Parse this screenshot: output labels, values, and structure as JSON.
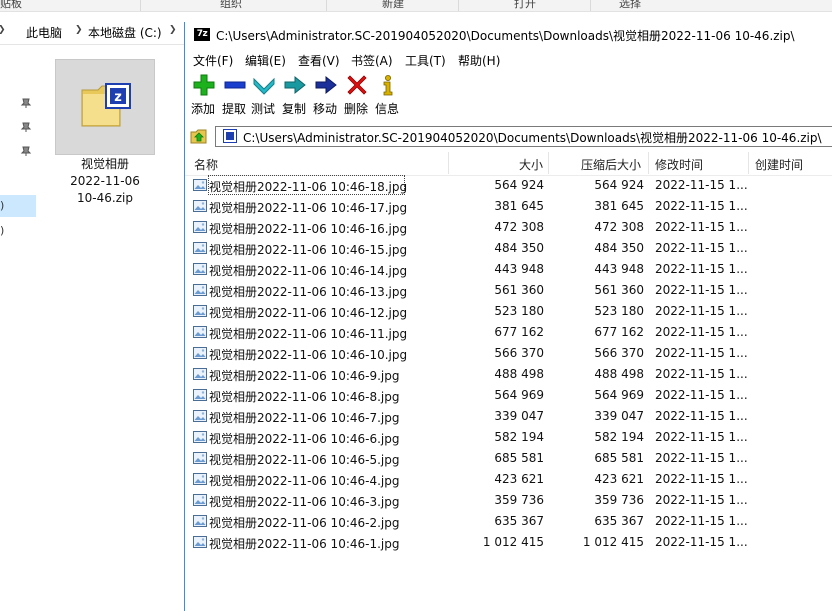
{
  "explorer": {
    "ribbon": [
      "贴板",
      "组织",
      "新建",
      "打开",
      "选择"
    ],
    "breadcrumb": [
      "此电脑",
      "本地磁盘 (C:)"
    ],
    "nav_fragments": [
      ")",
      ")"
    ],
    "selected_file": {
      "line1": "视觉相册",
      "line2": "2022-11-06",
      "line3": "10-46.zip"
    }
  },
  "sevenzip": {
    "app_logo": "7z",
    "title": "C:\\Users\\Administrator.SC-201904052020\\Documents\\Downloads\\视觉相册2022-11-06 10-46.zip\\",
    "menu": [
      "文件(F)",
      "编辑(E)",
      "查看(V)",
      "书签(A)",
      "工具(T)",
      "帮助(H)"
    ],
    "toolbar": [
      {
        "label": "添加",
        "icon": "plus-icon",
        "color": "#1db21d"
      },
      {
        "label": "提取",
        "icon": "minus-icon",
        "color": "#1a3fcf"
      },
      {
        "label": "测试",
        "icon": "check-chevron-icon",
        "color": "#26b9c8"
      },
      {
        "label": "复制",
        "icon": "copy-arrow-icon",
        "color": "#1a9aa0"
      },
      {
        "label": "移动",
        "icon": "arrow-right-icon",
        "color": "#1a2f9a"
      },
      {
        "label": "删除",
        "icon": "delete-x-icon",
        "color": "#e01010"
      },
      {
        "label": "信息",
        "icon": "info-icon",
        "color": "#d8b000"
      }
    ],
    "path": "C:\\Users\\Administrator.SC-201904052020\\Documents\\Downloads\\视觉相册2022-11-06 10-46.zip\\",
    "columns": {
      "name": "名称",
      "size": "大小",
      "packed": "压缩后大小",
      "modified": "修改时间",
      "created": "创建时间"
    },
    "files": [
      {
        "name": "视觉相册2022-11-06 10:46-18.jpg",
        "size": "564 924",
        "packed": "564 924",
        "modified": "2022-11-15 1..."
      },
      {
        "name": "视觉相册2022-11-06 10:46-17.jpg",
        "size": "381 645",
        "packed": "381 645",
        "modified": "2022-11-15 1..."
      },
      {
        "name": "视觉相册2022-11-06 10:46-16.jpg",
        "size": "472 308",
        "packed": "472 308",
        "modified": "2022-11-15 1..."
      },
      {
        "name": "视觉相册2022-11-06 10:46-15.jpg",
        "size": "484 350",
        "packed": "484 350",
        "modified": "2022-11-15 1..."
      },
      {
        "name": "视觉相册2022-11-06 10:46-14.jpg",
        "size": "443 948",
        "packed": "443 948",
        "modified": "2022-11-15 1..."
      },
      {
        "name": "视觉相册2022-11-06 10:46-13.jpg",
        "size": "561 360",
        "packed": "561 360",
        "modified": "2022-11-15 1..."
      },
      {
        "name": "视觉相册2022-11-06 10:46-12.jpg",
        "size": "523 180",
        "packed": "523 180",
        "modified": "2022-11-15 1..."
      },
      {
        "name": "视觉相册2022-11-06 10:46-11.jpg",
        "size": "677 162",
        "packed": "677 162",
        "modified": "2022-11-15 1..."
      },
      {
        "name": "视觉相册2022-11-06 10:46-10.jpg",
        "size": "566 370",
        "packed": "566 370",
        "modified": "2022-11-15 1..."
      },
      {
        "name": "视觉相册2022-11-06 10:46-9.jpg",
        "size": "488 498",
        "packed": "488 498",
        "modified": "2022-11-15 1..."
      },
      {
        "name": "视觉相册2022-11-06 10:46-8.jpg",
        "size": "564 969",
        "packed": "564 969",
        "modified": "2022-11-15 1..."
      },
      {
        "name": "视觉相册2022-11-06 10:46-7.jpg",
        "size": "339 047",
        "packed": "339 047",
        "modified": "2022-11-15 1..."
      },
      {
        "name": "视觉相册2022-11-06 10:46-6.jpg",
        "size": "582 194",
        "packed": "582 194",
        "modified": "2022-11-15 1..."
      },
      {
        "name": "视觉相册2022-11-06 10:46-5.jpg",
        "size": "685 581",
        "packed": "685 581",
        "modified": "2022-11-15 1..."
      },
      {
        "name": "视觉相册2022-11-06 10:46-4.jpg",
        "size": "423 621",
        "packed": "423 621",
        "modified": "2022-11-15 1..."
      },
      {
        "name": "视觉相册2022-11-06 10:46-3.jpg",
        "size": "359 736",
        "packed": "359 736",
        "modified": "2022-11-15 1..."
      },
      {
        "name": "视觉相册2022-11-06 10:46-2.jpg",
        "size": "635 367",
        "packed": "635 367",
        "modified": "2022-11-15 1..."
      },
      {
        "name": "视觉相册2022-11-06 10:46-1.jpg",
        "size": "1 012 415",
        "packed": "1 012 415",
        "modified": "2022-11-15 1..."
      }
    ]
  }
}
